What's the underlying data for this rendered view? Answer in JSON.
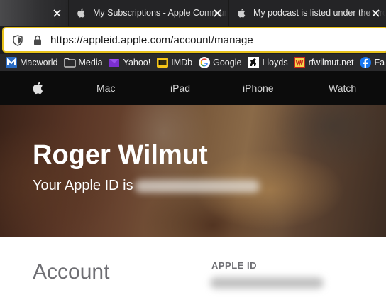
{
  "browser": {
    "tabs": [
      {
        "title": "",
        "icon": "image-thumbnail"
      },
      {
        "title": "My Subscriptions - Apple Community",
        "icon": "apple-icon"
      },
      {
        "title": "My podcast is listed under the wrong",
        "icon": "apple-icon"
      }
    ],
    "url": "https://appleid.apple.com/account/manage",
    "accent_color": "#e8c21c",
    "bookmarks": [
      {
        "label": "Macworld",
        "icon": "macworld-icon"
      },
      {
        "label": "Media",
        "icon": "folder-icon"
      },
      {
        "label": "Yahoo!",
        "icon": "yahoo-icon"
      },
      {
        "label": "IMDb",
        "icon": "imdb-icon"
      },
      {
        "label": "Google",
        "icon": "google-icon"
      },
      {
        "label": "Lloyds",
        "icon": "lloyds-icon"
      },
      {
        "label": "rfwilmut.net",
        "icon": "rfwilmut-icon"
      },
      {
        "label": "Fa",
        "icon": "facebook-icon"
      }
    ]
  },
  "apple_nav": {
    "items": [
      "Mac",
      "iPad",
      "iPhone",
      "Watch"
    ]
  },
  "hero": {
    "name": "Roger Wilmut",
    "subtitle": "Your Apple ID is"
  },
  "account": {
    "title": "Account",
    "apple_id_label": "APPLE ID"
  }
}
